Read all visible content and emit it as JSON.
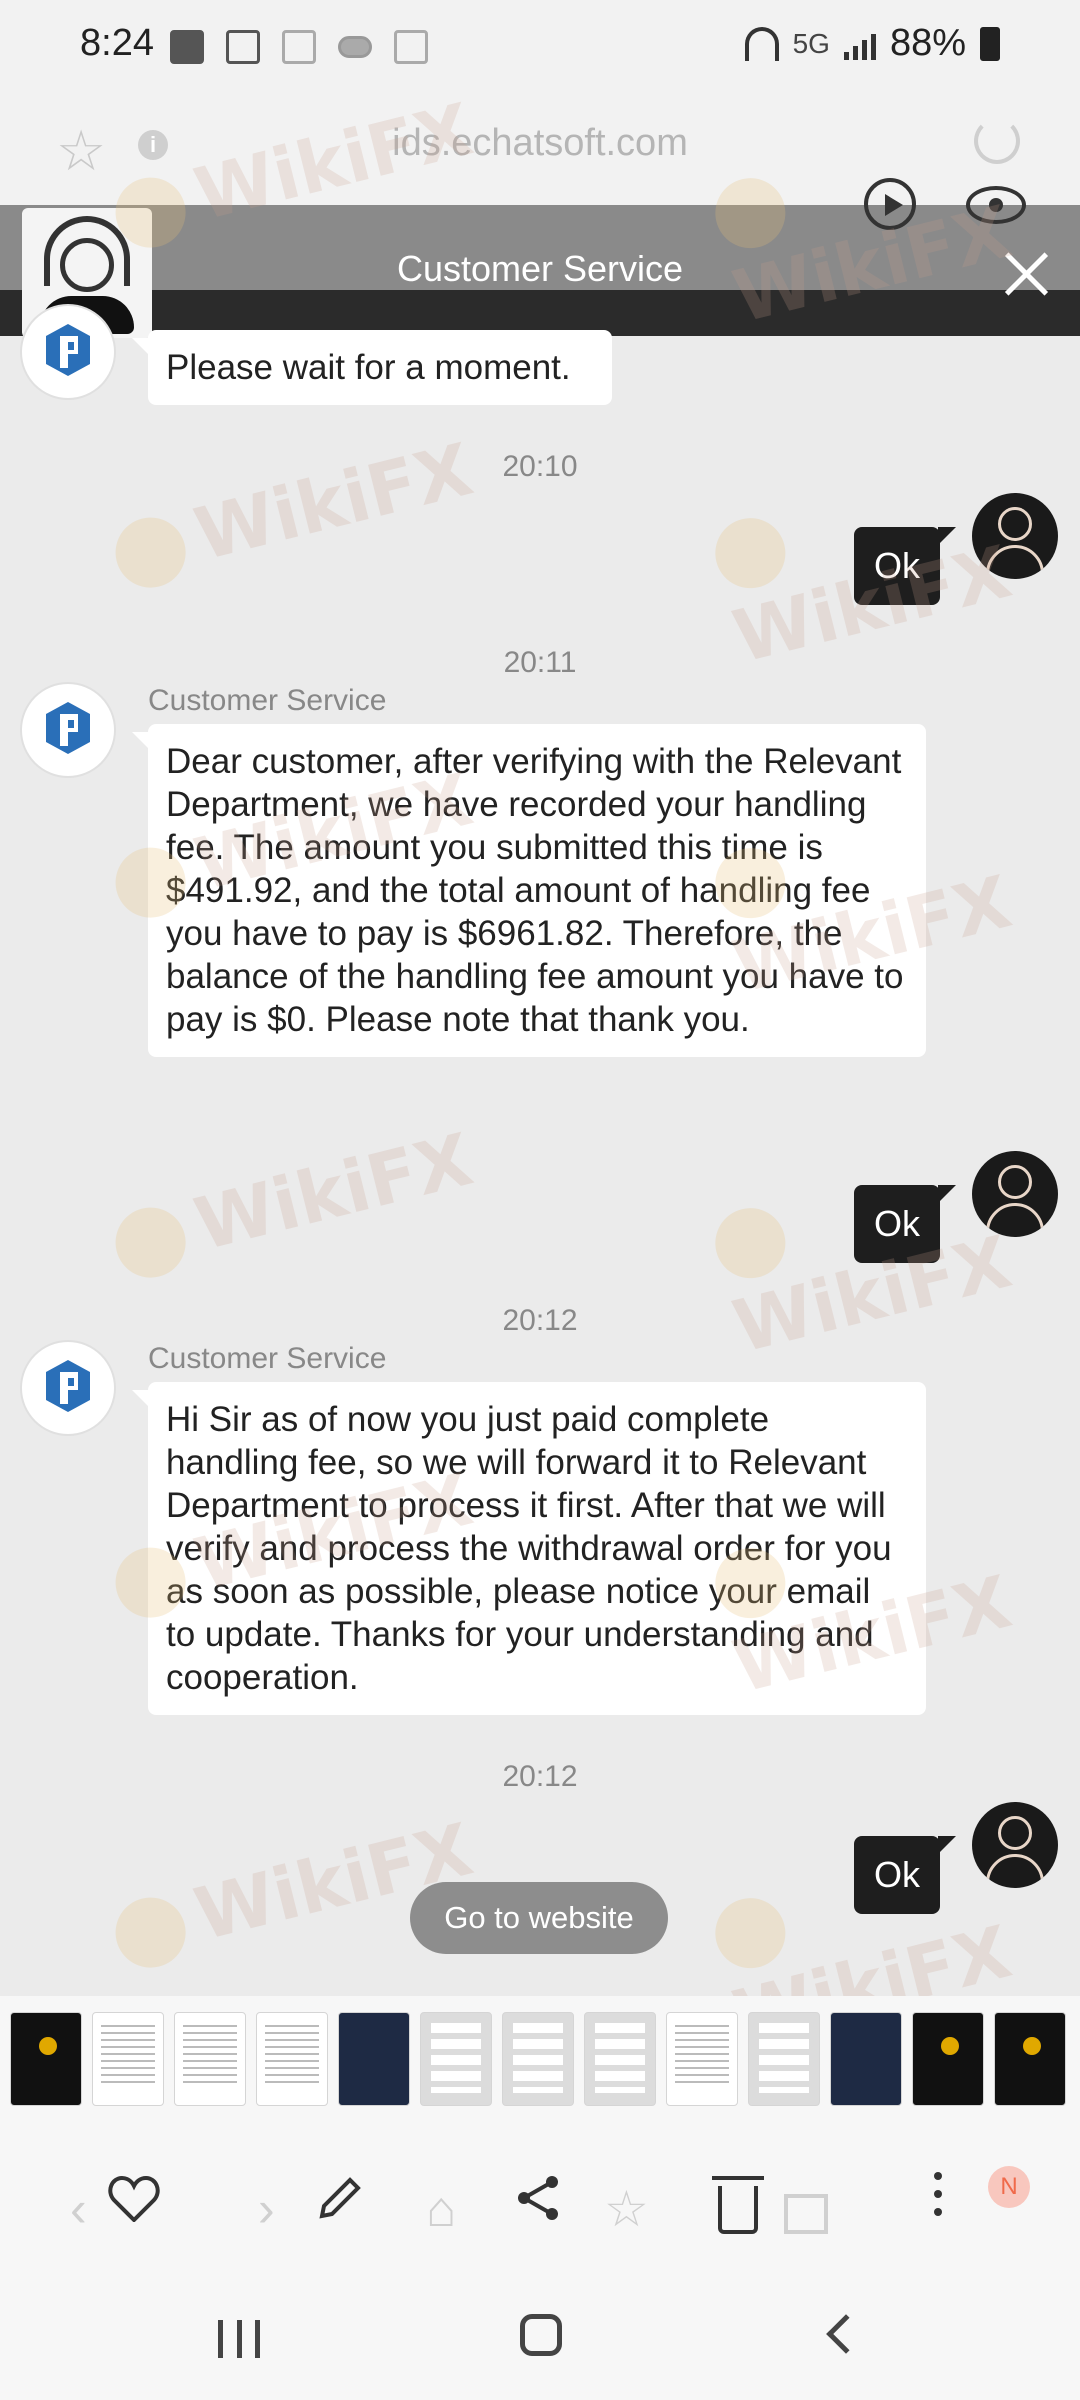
{
  "status_bar": {
    "time": "8:24",
    "network": "5G",
    "battery": "88%"
  },
  "browser": {
    "url": "ids.echatsoft.com"
  },
  "chat_header": {
    "title": "Customer Service"
  },
  "messages": [
    {
      "type": "left",
      "text": "Please wait for a moment."
    },
    {
      "type": "time",
      "text": "20:10"
    },
    {
      "type": "right",
      "text": "Ok"
    },
    {
      "type": "time",
      "text": "20:11"
    },
    {
      "type": "left",
      "sender": "Customer Service",
      "text": "Dear customer, after verifying with the Relevant Department, we have recorded your handling fee. The amount you submitted this time is $491.92, and the total amount of handling fee you have to pay is $6961.82. Therefore, the balance of the handling fee amount you have to pay is $0. Please note that thank you."
    },
    {
      "type": "right",
      "text": "Ok"
    },
    {
      "type": "time",
      "text": "20:12"
    },
    {
      "type": "left",
      "sender": "Customer Service",
      "text": "Hi Sir as of now you just paid complete handling fee, so we will forward it to Relevant Department to process it first. After that we will verify and process the withdrawal order for you as soon as possible, please notice your email to update. Thanks for your understanding and cooperation."
    },
    {
      "type": "time",
      "text": "20:12"
    },
    {
      "type": "right",
      "text": "Ok"
    }
  ],
  "goto_button": "Go to website",
  "watermark": "WikiFX",
  "toolbar": {
    "badge": "N"
  },
  "icons": {
    "favorite": "heart-icon",
    "edit": "pencil-icon",
    "share": "share-icon",
    "delete": "trash-icon",
    "more": "more-vert-icon"
  }
}
